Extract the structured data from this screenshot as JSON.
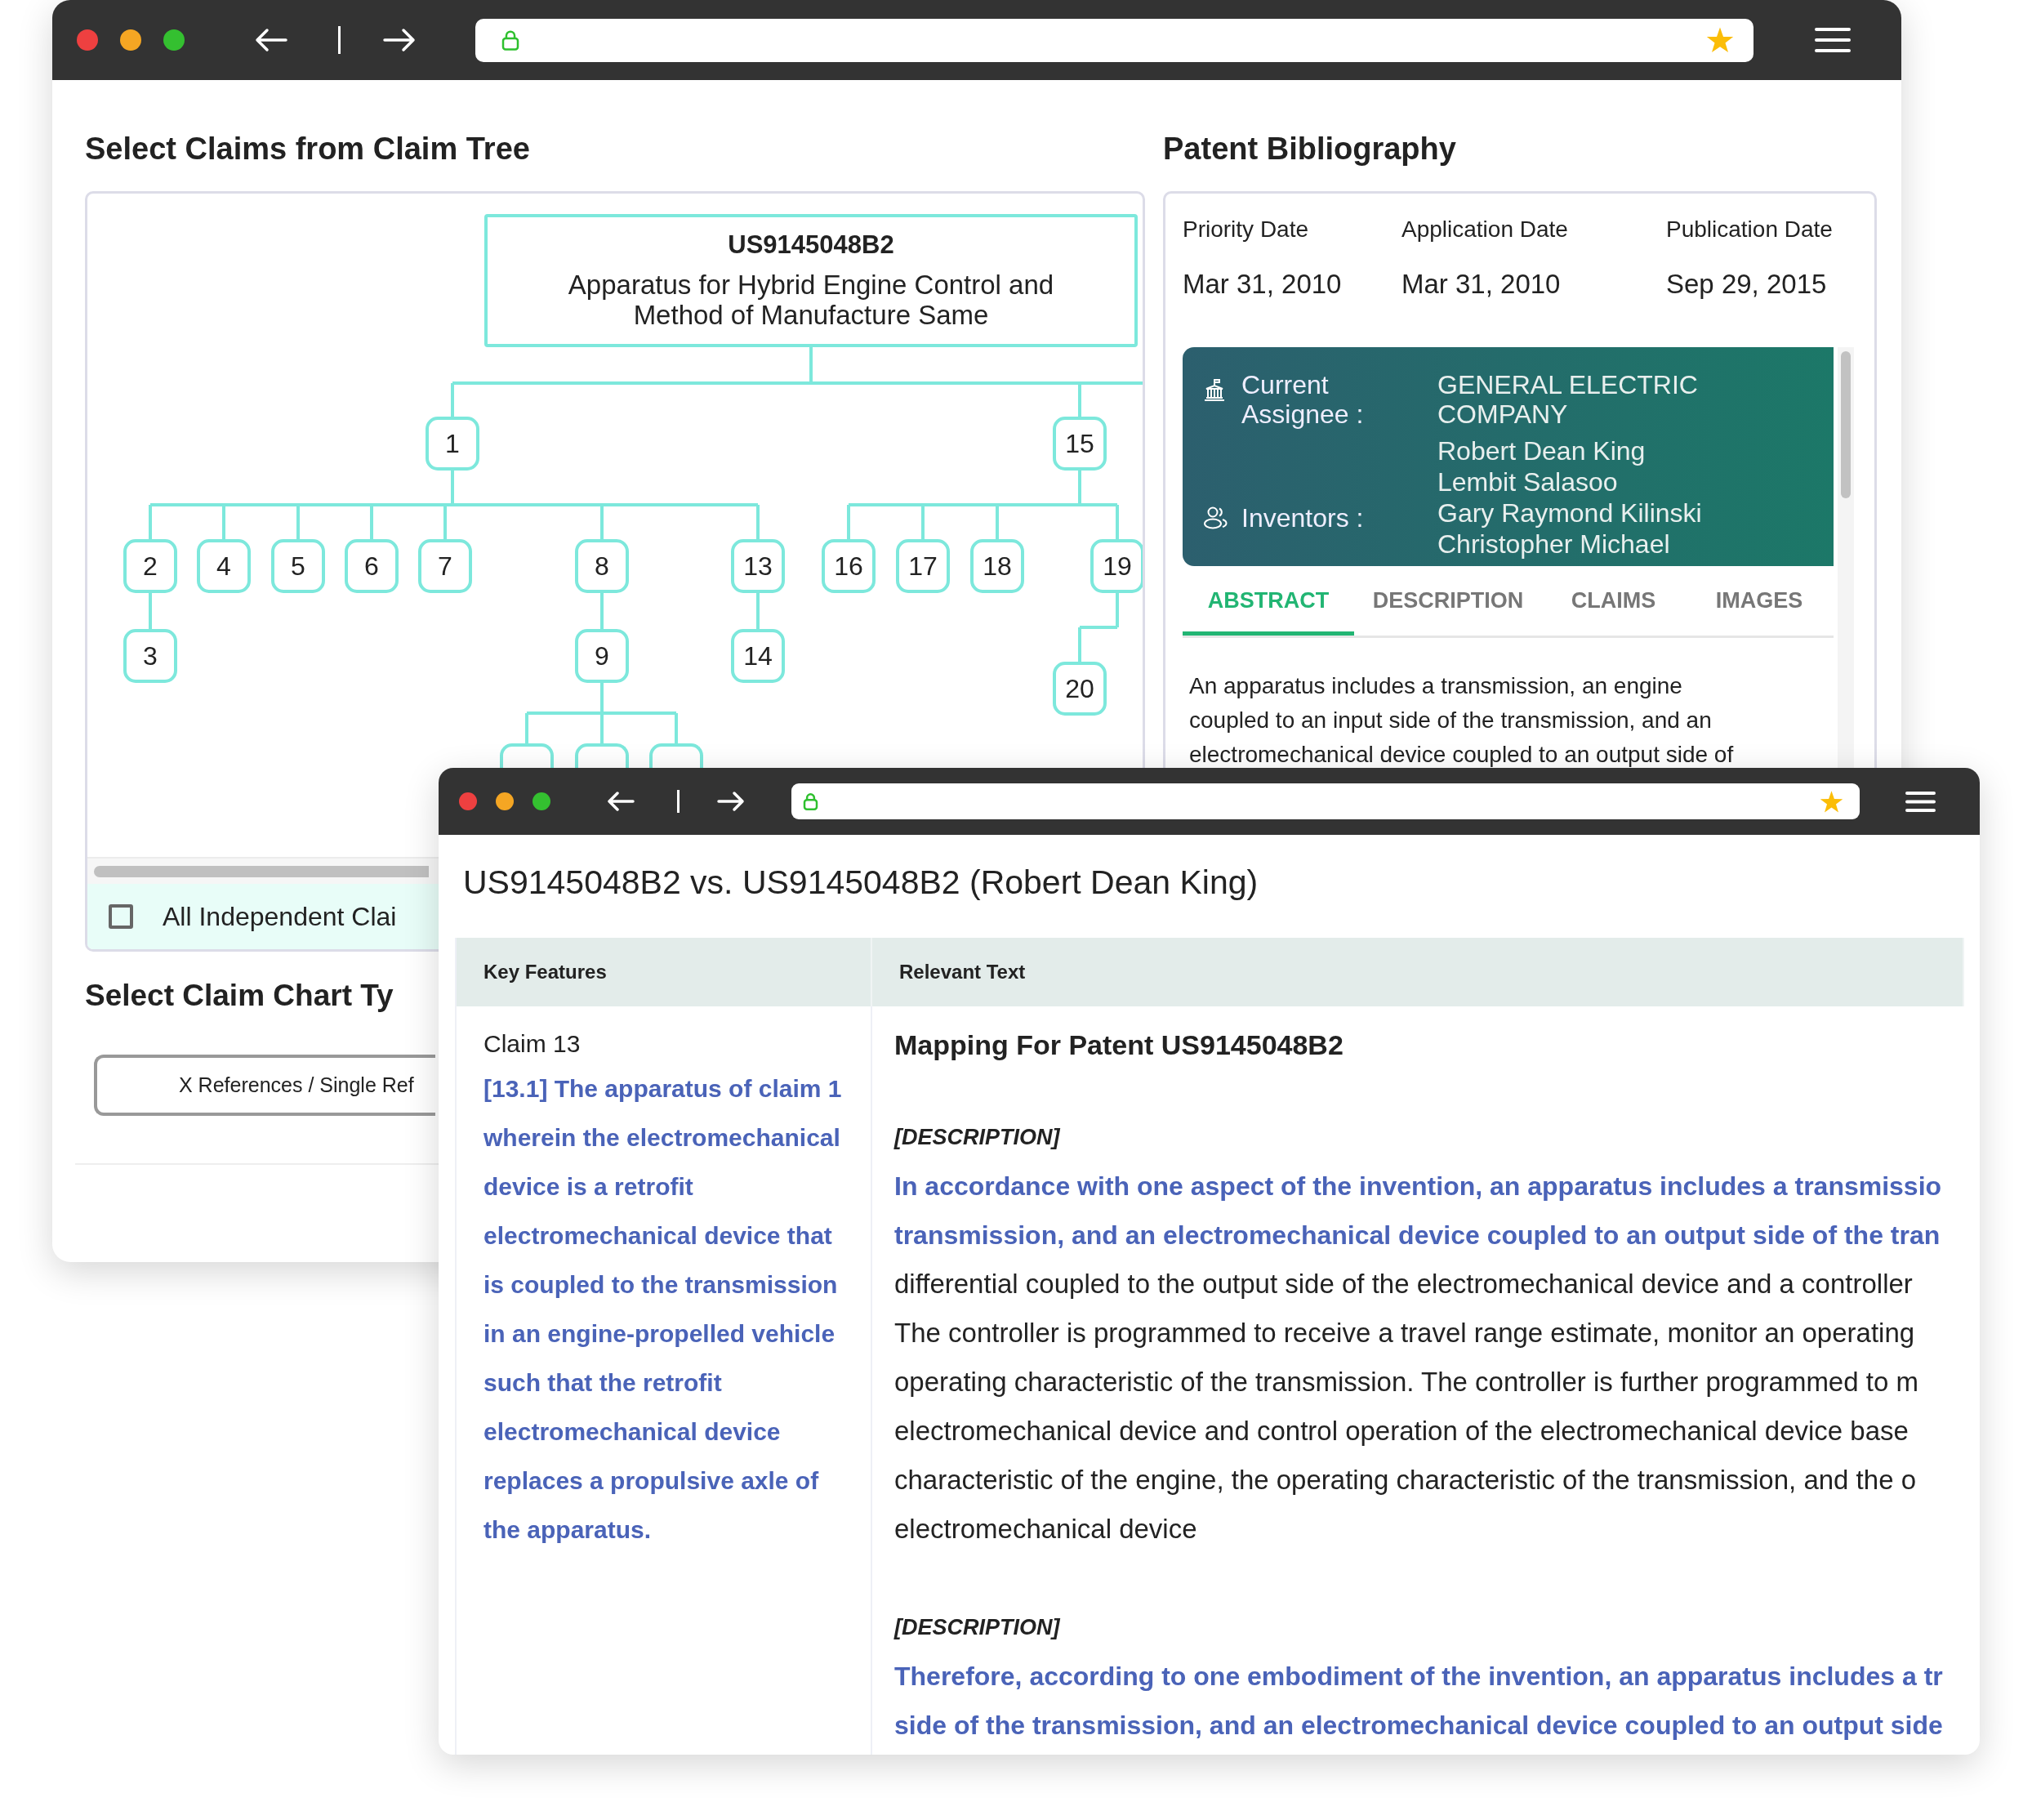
{
  "back_window": {
    "claim_tree_section": {
      "heading": "Select Claims from Claim Tree",
      "tree": {
        "patent_number": "US9145048B2",
        "title": "Apparatus for Hybrid Engine Control and Method of Manufacture Same",
        "children": [
          {
            "label": "1",
            "children": [
              {
                "label": "2",
                "children": [
                  {
                    "label": "3"
                  }
                ]
              },
              {
                "label": "4"
              },
              {
                "label": "5"
              },
              {
                "label": "6"
              },
              {
                "label": "7"
              },
              {
                "label": "8",
                "children": [
                  {
                    "label": "9",
                    "children": [
                      {
                        "partial": true
                      },
                      {
                        "partial": true
                      },
                      {
                        "partial": true
                      }
                    ]
                  }
                ]
              },
              {
                "label": "13",
                "children": [
                  {
                    "label": "14"
                  }
                ]
              }
            ]
          },
          {
            "label": "15",
            "children": [
              {
                "label": "16"
              },
              {
                "label": "17"
              },
              {
                "label": "18"
              },
              {
                "label": "19",
                "children": [
                  {
                    "label": "20"
                  }
                ]
              }
            ]
          }
        ]
      },
      "checkbox": {
        "label": "All Independent Clai",
        "checked": false
      }
    },
    "chart_type_section": {
      "heading": "Select Claim Chart Ty",
      "button": "X References / Single Ref"
    },
    "bibliography": {
      "heading": "Patent Bibliography",
      "dates": [
        {
          "label": "Priority Date",
          "value": "Mar 31, 2010"
        },
        {
          "label": "Application Date",
          "value": "Mar 31, 2010"
        },
        {
          "label": "Publication Date",
          "value": "Sep 29, 2015"
        }
      ],
      "assignee": {
        "label": "Current Assignee :",
        "value": "GENERAL ELECTRIC COMPANY"
      },
      "inventors": {
        "label": "Inventors :",
        "names": [
          "Robert Dean King",
          "Lembit Salasoo",
          "Gary Raymond Kilinski",
          "Christopher Michael"
        ]
      },
      "tabs": [
        {
          "label": "ABSTRACT",
          "selected": true
        },
        {
          "label": "DESCRIPTION",
          "selected": false
        },
        {
          "label": "CLAIMS",
          "selected": false
        },
        {
          "label": "IMAGES",
          "selected": false
        }
      ],
      "abstract_lines": [
        "An apparatus includes a transmission, an engine",
        "coupled to an input side of the transmission, and an",
        "electromechanical device coupled to an output side of"
      ]
    }
  },
  "front_window": {
    "title": "US9145048B2 vs. US9145048B2 (Robert Dean King)",
    "table": {
      "columns": [
        "Key Features",
        "Relevant Text"
      ],
      "row": {
        "claim": "Claim 13",
        "claim_text": "[13.1] The apparatus of claim 1 wherein the electromechanical device is a retrofit electromechanical device that is coupled to the transmission in an engine-propelled vehicle such that the retrofit electromechanical device replaces a propulsive axle of the apparatus.",
        "mapping_heading": "Mapping For Patent US9145048B2",
        "passages": [
          {
            "source": "[DESCRIPTION]",
            "lines": [
              {
                "text": "In accordance with one aspect of the invention, an apparatus includes a transmissio",
                "highlighted": true
              },
              {
                "text": "transmission, and an electromechanical device coupled to an output side of the tran",
                "highlighted": true
              },
              {
                "text": "differential coupled to the output side of the electromechanical device and a controller",
                "highlighted": false
              },
              {
                "text": "The controller is programmed to receive a travel range estimate, monitor an operating",
                "highlighted": false
              },
              {
                "text": "operating characteristic of the transmission. The controller is further programmed to m",
                "highlighted": false
              },
              {
                "text": "electromechanical device and control operation of the electromechanical device base",
                "highlighted": false
              },
              {
                "text": "characteristic of the engine, the operating characteristic of the transmission, and the o",
                "highlighted": false
              },
              {
                "text": "electromechanical device",
                "highlighted": false
              }
            ]
          },
          {
            "source": "[DESCRIPTION]",
            "lines": [
              {
                "text": "Therefore, according to one embodiment of the invention, an apparatus includes a tr",
                "highlighted": true
              },
              {
                "text": "side of the transmission, and an electromechanical device coupled to an output side",
                "highlighted": true
              }
            ]
          }
        ]
      }
    }
  }
}
